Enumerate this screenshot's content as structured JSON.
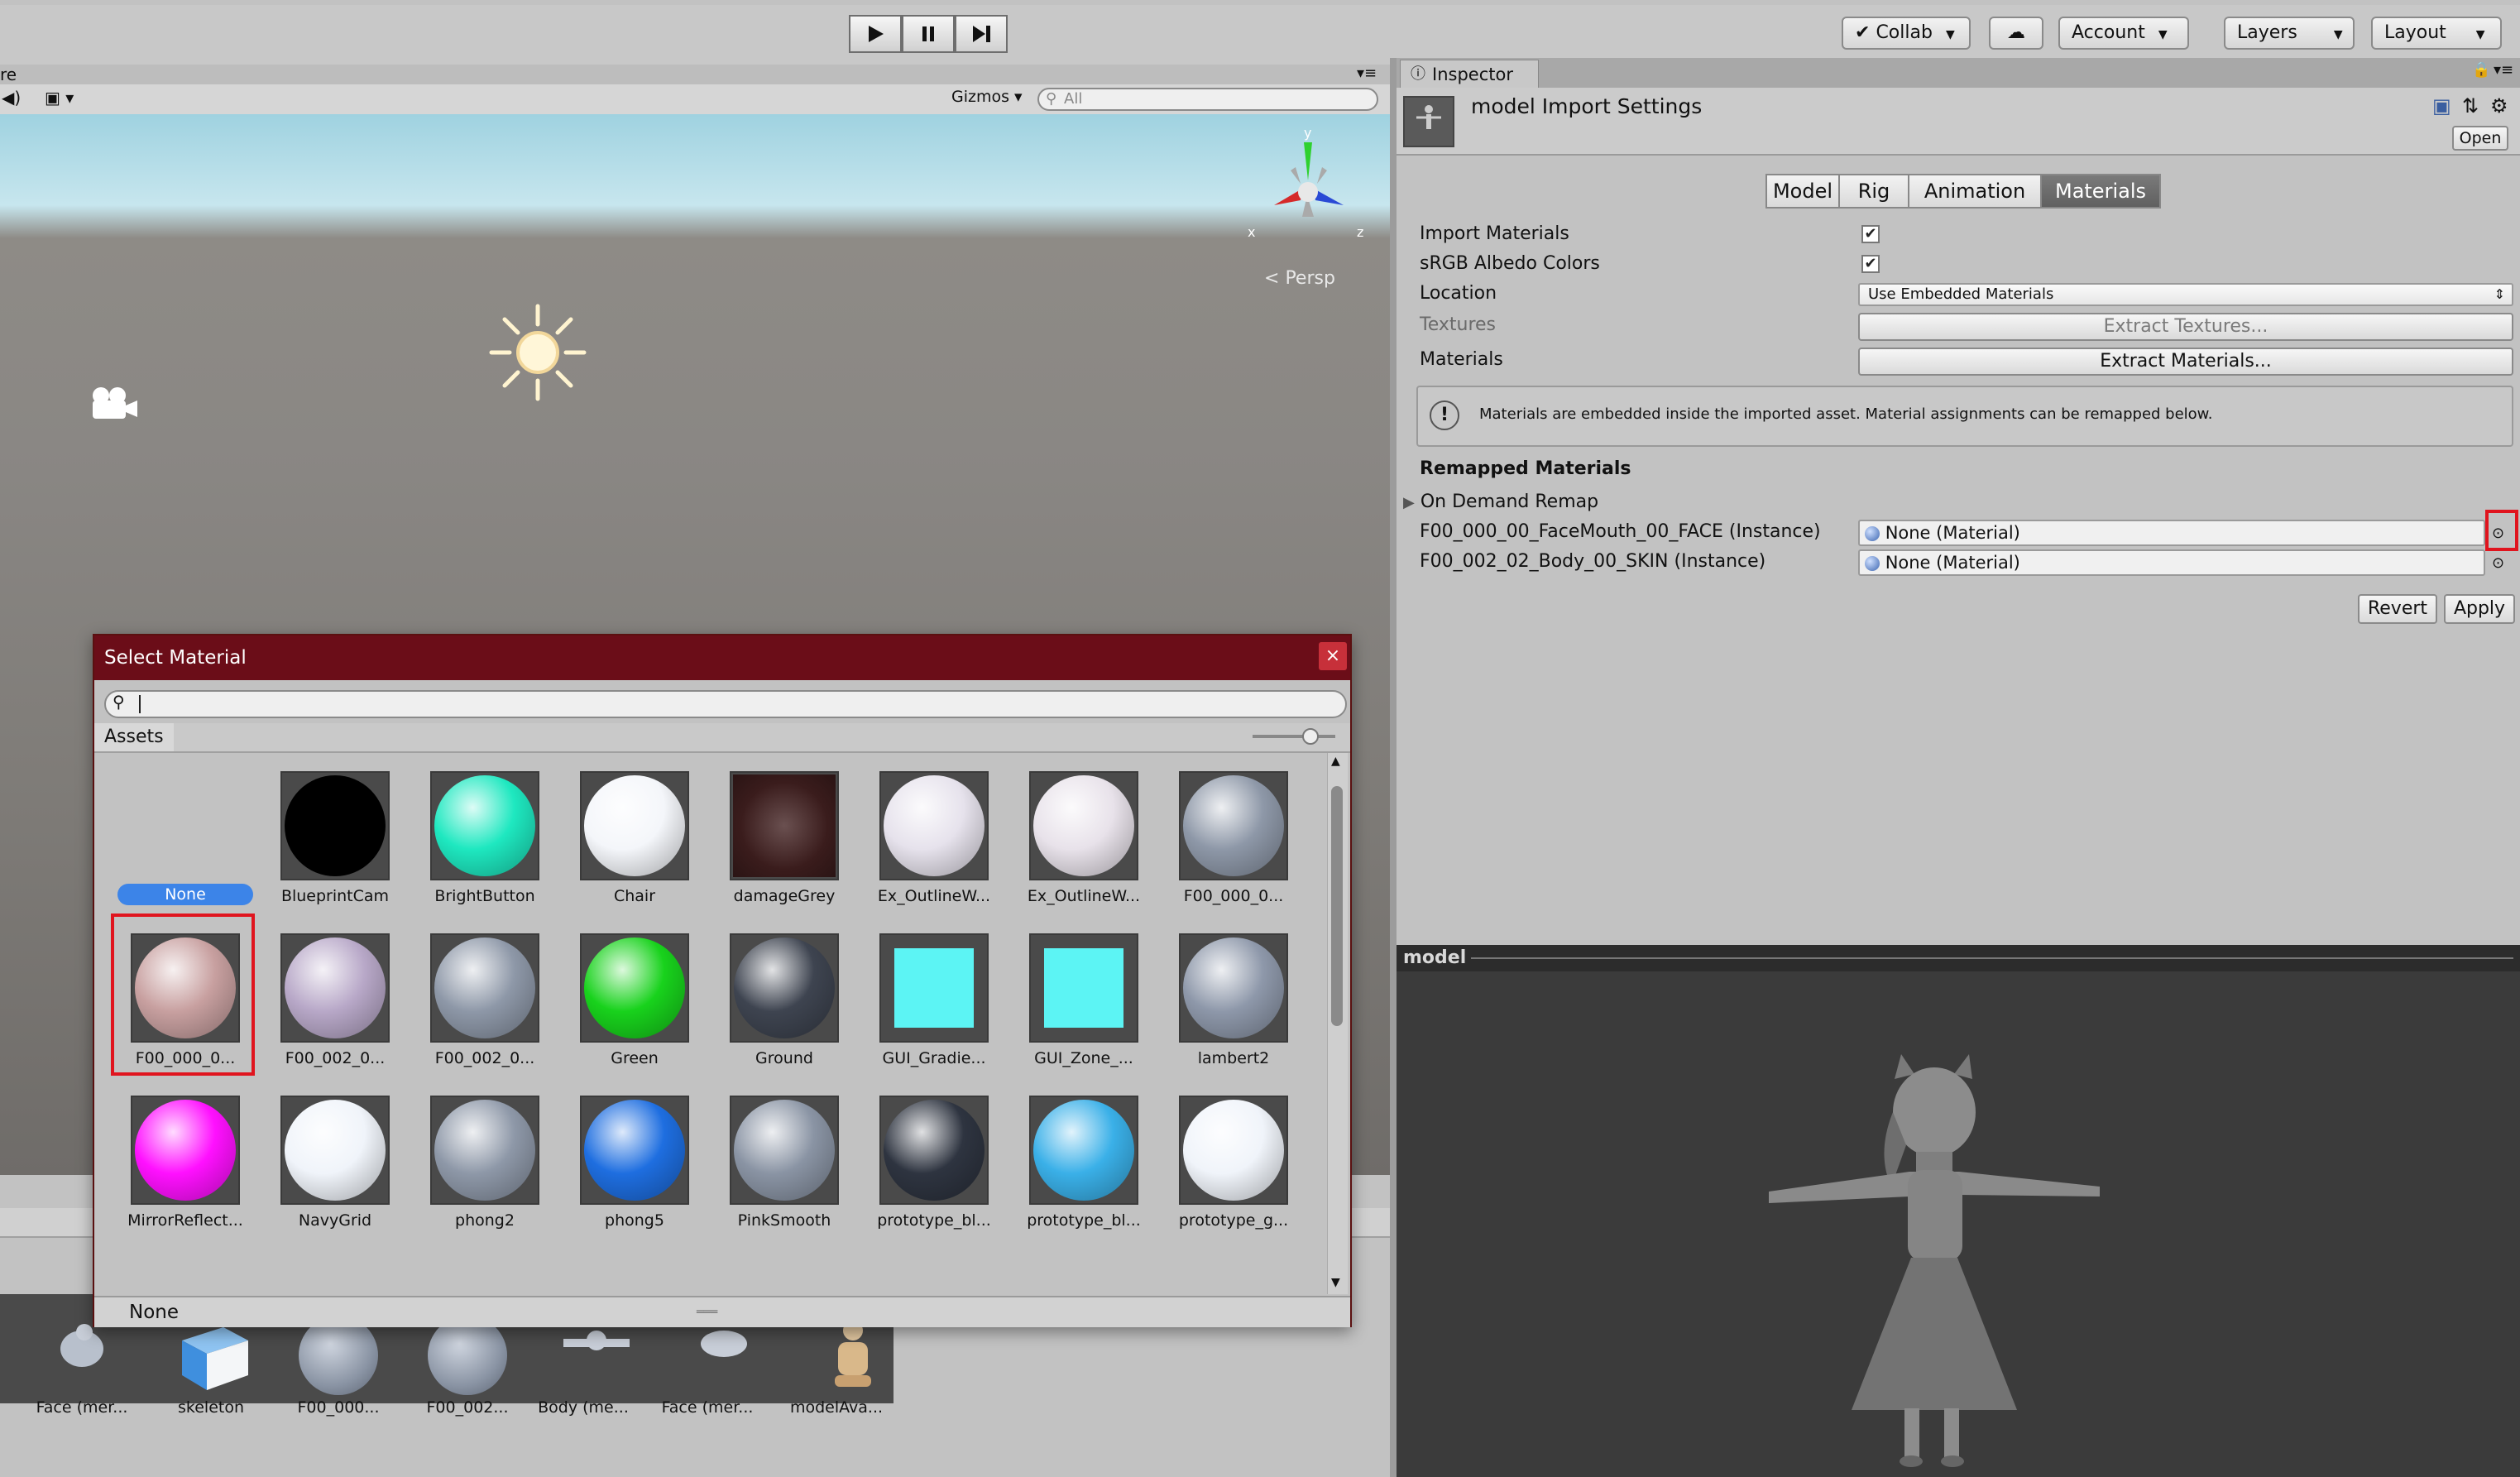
{
  "toolbar": {
    "collab": "Collab",
    "account": "Account",
    "layers": "Layers",
    "layout": "Layout"
  },
  "scene": {
    "gizmos": "Gizmos",
    "search_placeholder": "All",
    "persp": "Persp",
    "axis_x": "x",
    "axis_y": "y",
    "axis_z": "z",
    "tab_fragment": "re"
  },
  "inspector": {
    "tab": "Inspector",
    "title": "model Import Settings",
    "open_button": "Open",
    "tabs": [
      "Model",
      "Rig",
      "Animation",
      "Materials"
    ],
    "active_tab": "Materials",
    "import_materials_label": "Import Materials",
    "import_materials_checked": true,
    "srgb_label": "sRGB Albedo Colors",
    "srgb_checked": true,
    "location_label": "Location",
    "location_value": "Use Embedded Materials",
    "textures_label": "Textures",
    "extract_textures": "Extract Textures...",
    "materials_label": "Materials",
    "extract_materials": "Extract Materials...",
    "info": "Materials are embedded inside the imported asset. Material assignments can be remapped below.",
    "remapped_header": "Remapped Materials",
    "on_demand": "On Demand Remap",
    "remap_rows": [
      {
        "name": "F00_000_00_FaceMouth_00_FACE (Instance)",
        "value": "None (Material)"
      },
      {
        "name": "F00_002_02_Body_00_SKIN (Instance)",
        "value": "None (Material)"
      }
    ],
    "revert": "Revert",
    "apply": "Apply"
  },
  "preview": {
    "title": "model"
  },
  "dialog": {
    "title": "Select Material",
    "close": "×",
    "assets_tab": "Assets",
    "status": "None",
    "none_label": "None",
    "items": [
      {
        "label": "BlueprintCam",
        "color": "#000000"
      },
      {
        "label": "BrightButton",
        "color": "#1ee8c0"
      },
      {
        "label": "Chair",
        "color": "#f4f6fa"
      },
      {
        "label": "damageGrey",
        "color": "#3a1c1c"
      },
      {
        "label": "Ex_OutlineW...",
        "color": "#e6e2ec"
      },
      {
        "label": "Ex_OutlineW...",
        "color": "#e8e2ea"
      },
      {
        "label": "F00_000_0...",
        "color": "#8e98a8"
      },
      {
        "label": "F00_000_0...",
        "color": "#c8a0a0"
      },
      {
        "label": "F00_002_0...",
        "color": "#b8a8c8"
      },
      {
        "label": "F00_002_0...",
        "color": "#8e98a8"
      },
      {
        "label": "Green",
        "color": "#18d21c"
      },
      {
        "label": "Ground",
        "color": "#3e4450"
      },
      {
        "label": "GUI_Gradie...",
        "color": "#5cf4f4"
      },
      {
        "label": "GUI_Zone_...",
        "color": "#5cf4f4"
      },
      {
        "label": "lambert2",
        "color": "#8e98aa"
      },
      {
        "label": "MirrorReflect...",
        "color": "#ff10ff"
      },
      {
        "label": "NavyGrid",
        "color": "#f0f4fa"
      },
      {
        "label": "phong2",
        "color": "#8e98a8"
      },
      {
        "label": "phong5",
        "color": "#1e6ee0"
      },
      {
        "label": "PinkSmooth",
        "color": "#8a94a4"
      },
      {
        "label": "prototype_bl...",
        "color": "#2e3440"
      },
      {
        "label": "prototype_bl...",
        "color": "#3ab0e8"
      },
      {
        "label": "prototype_g...",
        "color": "#f0f4fa"
      }
    ]
  },
  "project": {
    "items": [
      "Face (mer...",
      "skeleton",
      "F00_000...",
      "F00_002...",
      "Body (me...",
      "Face (mer...",
      "modelAva..."
    ]
  }
}
